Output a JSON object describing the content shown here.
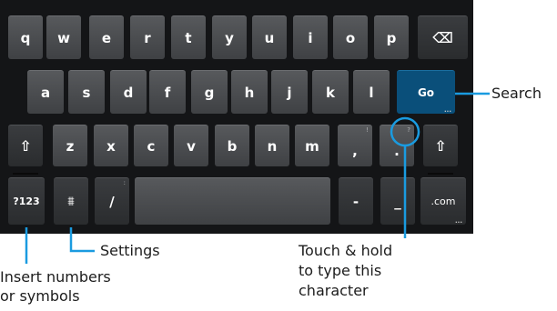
{
  "keyboard": {
    "row1": [
      "q",
      "w",
      "e",
      "r",
      "t",
      "y",
      "u",
      "i",
      "o",
      "p"
    ],
    "row2": [
      "a",
      "s",
      "d",
      "f",
      "g",
      "h",
      "j",
      "k",
      "l"
    ],
    "row3": [
      "z",
      "x",
      "c",
      "v",
      "b",
      "n",
      "m"
    ],
    "go_label": "Go",
    "numbers_label": "?123",
    "settings_glyph": "⩩",
    "slash_label": "/",
    "slash_hint": ":",
    "comma_label": ",",
    "comma_hint": "!",
    "period_label": ".",
    "period_hint": "?",
    "dash_label": "-",
    "underscore_label": "_",
    "com_label": ".com",
    "shift_glyph": "⇧",
    "backspace_glyph": "⌫",
    "more_dots": "...",
    "accent_color": "#1a9be0"
  },
  "callouts": {
    "search": "Search",
    "settings": "Settings",
    "numbers_line1": "Insert numbers",
    "numbers_line2": "or symbols",
    "hold_line1": "Touch & hold",
    "hold_line2": "to type this",
    "hold_line3": "character"
  }
}
